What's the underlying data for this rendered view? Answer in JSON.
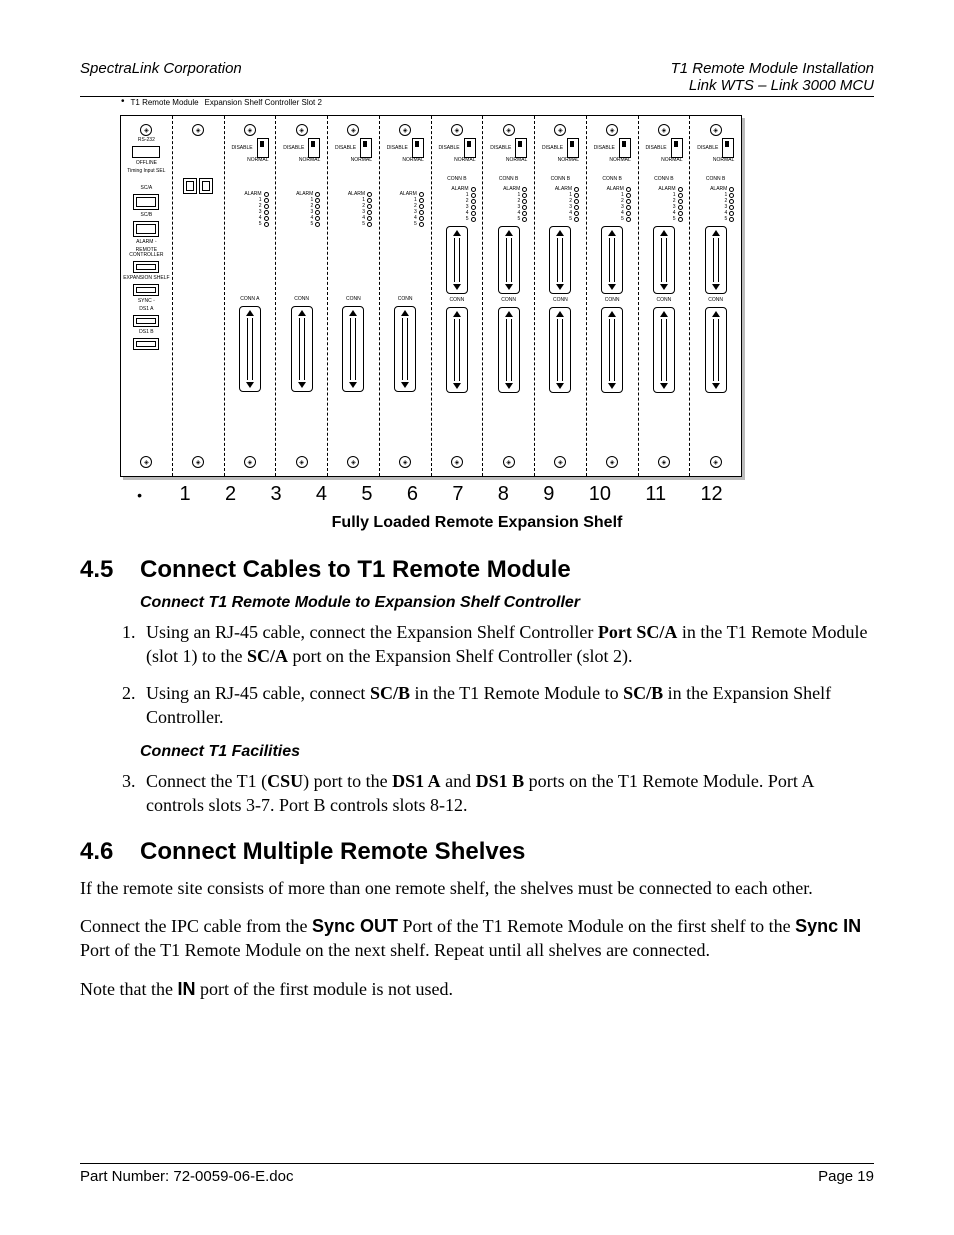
{
  "header": {
    "left": "SpectraLink Corporation",
    "right_line1": "T1 Remote Module Installation",
    "right_line2": "Link WTS – Link 3000 MCU"
  },
  "footer": {
    "left": "Part Number: 72-0059-06-E.doc",
    "right": "Page 19"
  },
  "diagram": {
    "top_label_1": "T1 Remote Module",
    "top_label_2": "Expansion Shelf Controller Slot 2",
    "caption": "Fully Loaded Remote Expansion Shelf",
    "slot1": {
      "rs232": "RS-232",
      "offline": "OFFLINE",
      "timing": "Timing Input SEL",
      "sca": "SC/A",
      "scb": "SC/B",
      "alarm": "ALARM",
      "remote": "REMOTE CONTROLLER",
      "expansion": "EXPANSION SHELF",
      "sync": "SYNC",
      "ds1a": "DS1 A",
      "ds1b": "DS1 B"
    },
    "generic": {
      "disable": "DISABLE",
      "normal": "NORMAL",
      "alarm": "ALARM",
      "alarm_nums": [
        "1",
        "2",
        "3",
        "4",
        "5"
      ],
      "conn": "CONN",
      "conn_a": "CONN A",
      "conn_b": "CONN B"
    },
    "slot_numbers": [
      "1",
      "2",
      "3",
      "4",
      "5",
      "6",
      "7",
      "8",
      "9",
      "10",
      "11",
      "12"
    ]
  },
  "section45": {
    "num": "4.5",
    "title": "Connect Cables to T1 Remote Module",
    "sub1": "Connect T1 Remote Module to Expansion Shelf Controller",
    "step1_a": "Using an RJ-45 cable, connect the Expansion Shelf Controller ",
    "step1_b_bold": "Port SC/A",
    "step1_c": " in the T1 Remote Module (slot 1) to the ",
    "step1_d_bold": "SC/A",
    "step1_e": " port on the Expansion Shelf Controller (slot 2).",
    "step2_a": "Using an RJ-45 cable, connect ",
    "step2_b_bold": "SC/B",
    "step2_c": " in the T1 Remote Module to ",
    "step2_d_bold": "SC/B",
    "step2_e": " in the Expansion Shelf Controller.",
    "sub2": "Connect T1 Facilities",
    "step3_a": "Connect the T1 (",
    "step3_b_bold": "CSU",
    "step3_c": ") port to the ",
    "step3_d_bold": "DS1 A",
    "step3_e": " and ",
    "step3_f_bold": "DS1 B",
    "step3_g": " ports on the T1 Remote Module.  Port A controls slots 3-7.  Port B controls slots 8-12."
  },
  "section46": {
    "num": "4.6",
    "title": "Connect Multiple Remote Shelves",
    "p1": "If the remote site consists of more than one remote shelf, the shelves must be connected to each other.",
    "p2_a": "Connect the IPC cable from the ",
    "p2_b_bold": "Sync OUT",
    "p2_c": " Port of the T1 Remote Module on the first shelf to the ",
    "p2_d_bold": "Sync IN",
    "p2_e": " Port of the T1 Remote Module on the next shelf.  Repeat until all shelves are connected.",
    "p3_a": "Note that the ",
    "p3_b_bold": "IN",
    "p3_c": " port of the first module is not used."
  }
}
